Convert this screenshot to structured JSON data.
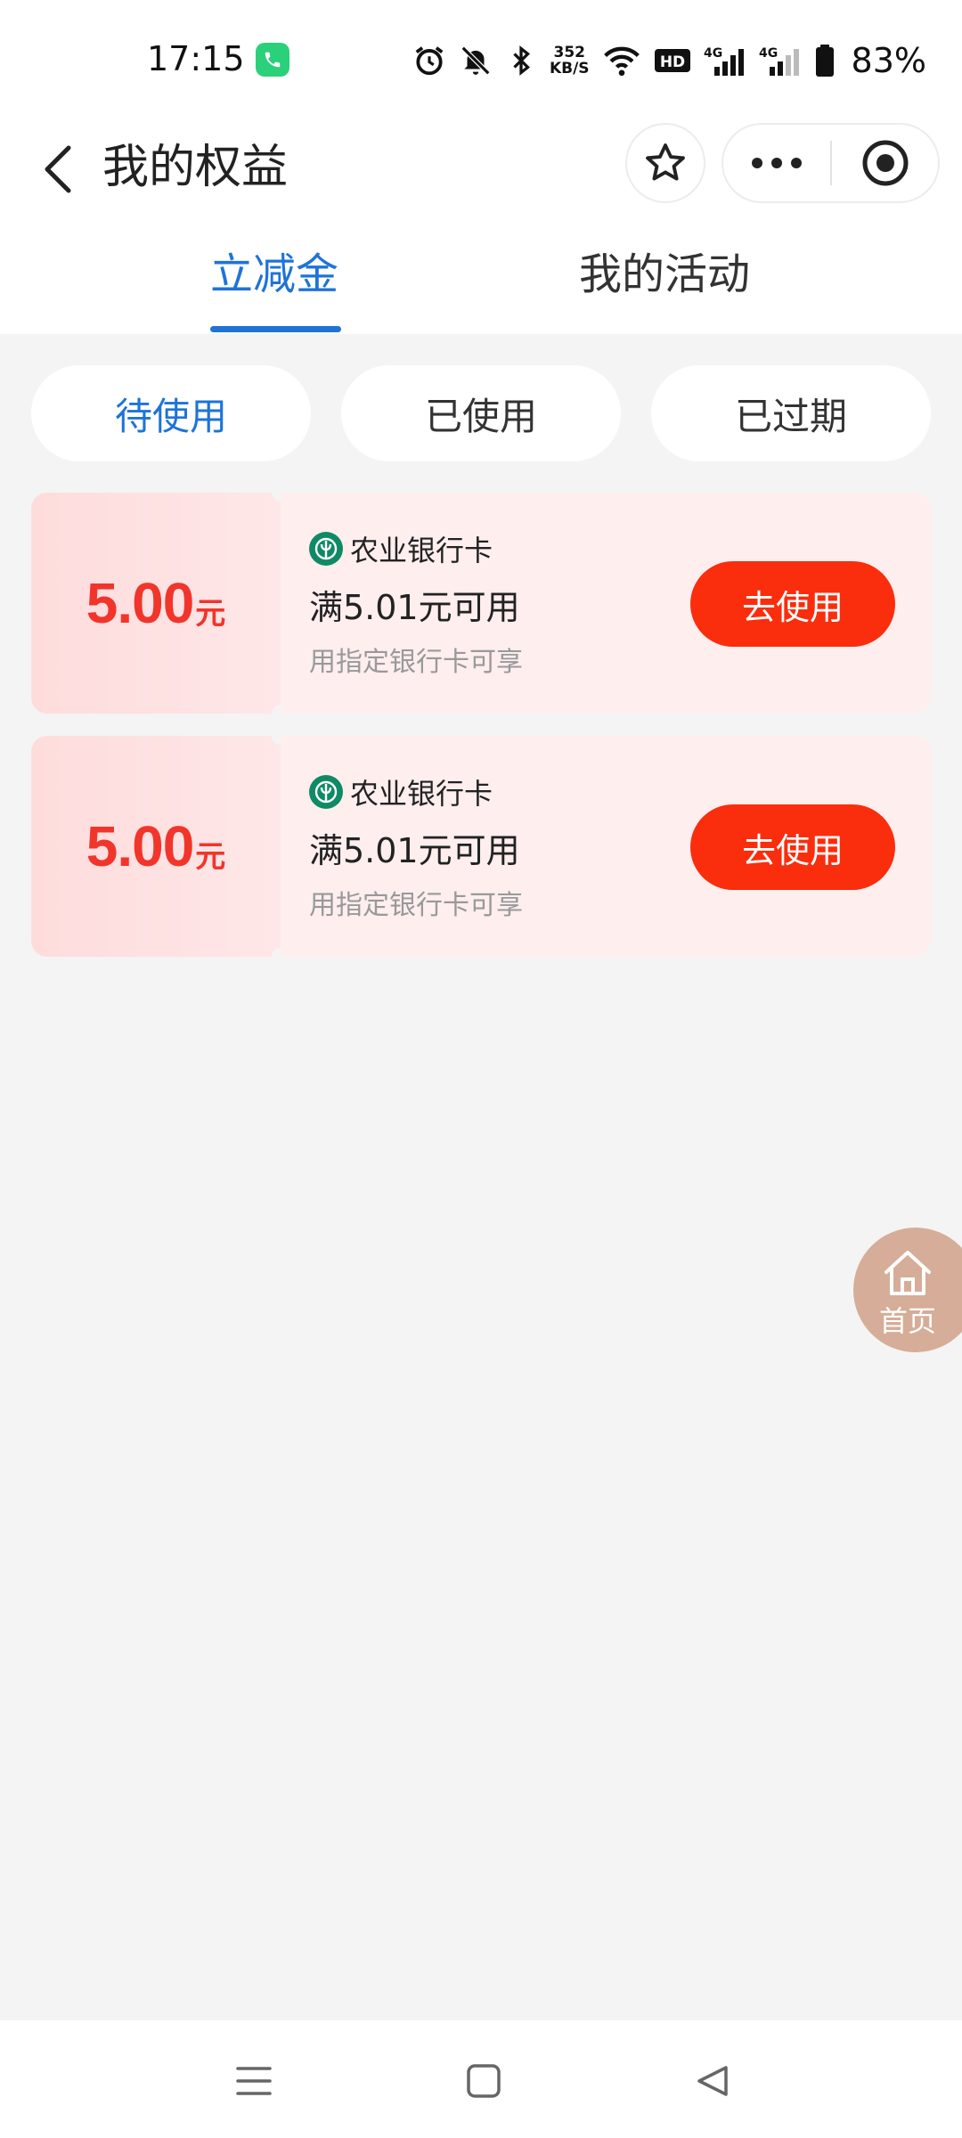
{
  "status_bar": {
    "time": "17:15",
    "net_speed_value": "352",
    "net_speed_unit": "KB/S",
    "hd_label": "HD",
    "signal_1_label": "4G",
    "signal_2_label": "4G",
    "battery_percent": "83%"
  },
  "header": {
    "title": "我的权益"
  },
  "top_tabs": [
    {
      "label": "立减金",
      "active": true
    },
    {
      "label": "我的活动",
      "active": false
    }
  ],
  "filters": [
    {
      "label": "待使用",
      "active": true
    },
    {
      "label": "已使用",
      "active": false
    },
    {
      "label": "已过期",
      "active": false
    }
  ],
  "coupons": [
    {
      "amount": "5.00",
      "unit": "元",
      "bank": "农业银行卡",
      "condition": "满5.01元可用",
      "note": "用指定银行卡可享",
      "button": "去使用"
    },
    {
      "amount": "5.00",
      "unit": "元",
      "bank": "农业银行卡",
      "condition": "满5.01元可用",
      "note": "用指定银行卡可享",
      "button": "去使用"
    }
  ],
  "float_home": {
    "label": "首页"
  },
  "colors": {
    "accent": "#1e73d8",
    "coupon_red": "#f1352b",
    "button_red": "#fa2d0d",
    "bank_green": "#0f8a64"
  }
}
